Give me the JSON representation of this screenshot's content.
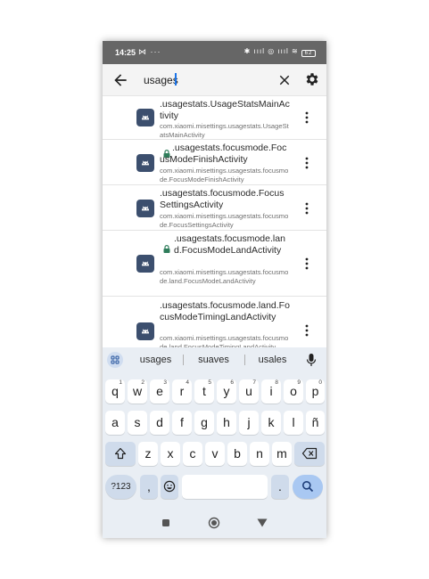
{
  "status": {
    "time": "14:25",
    "left_icons": "⋈ ···",
    "right_icons": "✱ ıııl ◎ ıııl ≋",
    "battery": "62"
  },
  "search": {
    "value": "usages"
  },
  "results": [
    {
      "title": ".usagestats.UsageStatsMainActivity",
      "subtitle": "com.xiaomi.misettings.usagestats.UsageStatsMainActivity",
      "locked": false
    },
    {
      "title": ".usagestats.focusmode.FocusModeFinishActivity",
      "subtitle": "com.xiaomi.misettings.usagestats.focusmode.FocusModeFinishActivity",
      "locked": true
    },
    {
      "title": ".usagestats.focusmode.FocusSettingsActivity",
      "subtitle": "com.xiaomi.misettings.usagestats.focusmode.FocusSettingsActivity",
      "locked": false
    },
    {
      "title": ".usagestats.focusmode.land.FocusModeLandActivity",
      "subtitle": "com.xiaomi.misettings.usagestats.focusmode.land.FocusModeLandActivity",
      "locked": true
    },
    {
      "title": ".usagestats.focusmode.land.FocusModeTimingLandActivity",
      "subtitle": "com.xiaomi.misettings.usagestats.focusmode.land.FocusModeTimingLandActivity",
      "locked": false
    }
  ],
  "keyboard": {
    "suggestions": [
      "usages",
      "suaves",
      "usales"
    ],
    "row1": [
      {
        "key": "q",
        "sup": "1"
      },
      {
        "key": "w",
        "sup": "2"
      },
      {
        "key": "e",
        "sup": "3"
      },
      {
        "key": "r",
        "sup": "4"
      },
      {
        "key": "t",
        "sup": "5"
      },
      {
        "key": "y",
        "sup": "6"
      },
      {
        "key": "u",
        "sup": "7"
      },
      {
        "key": "i",
        "sup": "8"
      },
      {
        "key": "o",
        "sup": "9"
      },
      {
        "key": "p",
        "sup": "0"
      }
    ],
    "row2": [
      "a",
      "s",
      "d",
      "f",
      "g",
      "h",
      "j",
      "k",
      "l",
      "ñ"
    ],
    "row3": [
      "z",
      "x",
      "c",
      "v",
      "b",
      "n",
      "m"
    ],
    "symbols_label": "?123",
    "comma": ",",
    "period": "."
  },
  "colors": {
    "status_bar": "#666666",
    "app_icon": "#3c4f6e",
    "lock": "#2f7d5b",
    "keyboard_bg": "#e9eef4",
    "enter_key": "#a9c8f2",
    "caret": "#1a73e8"
  }
}
